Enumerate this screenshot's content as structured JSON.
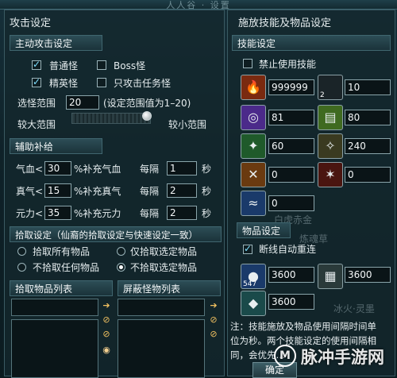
{
  "window": {
    "title": "人人谷 · 设置"
  },
  "left": {
    "section_attack": "攻击设定",
    "section_main_attack": "主动攻击设定",
    "checks": [
      {
        "label": "普通怪",
        "checked": true
      },
      {
        "label": "Boss怪",
        "checked": false
      },
      {
        "label": "精英怪",
        "checked": true
      },
      {
        "label": "只攻击任务怪",
        "checked": false
      }
    ],
    "range_label": "选怪范围",
    "range_value": "20",
    "range_hint": "(设定范围值为1–20)",
    "slider_left": "较大范围",
    "slider_right": "较小范围",
    "slider_level": 0.95,
    "section_supply": "辅助补给",
    "supply": [
      {
        "prefix": "气血<",
        "value": "30",
        "suffix": "%补充气血",
        "every": "每隔",
        "seconds": "1",
        "unit": "秒"
      },
      {
        "prefix": "真气<",
        "value": "15",
        "suffix": "%补充真气",
        "every": "每隔",
        "seconds": "2",
        "unit": "秒"
      },
      {
        "prefix": "元力<",
        "value": "35",
        "suffix": "%补充元力",
        "every": "每隔",
        "seconds": "2",
        "unit": "秒"
      }
    ],
    "section_pickup": "拾取设定（仙裔的拾取设定与快速设定一致）",
    "pickup_options": [
      {
        "label": "拾取所有物品",
        "on": false
      },
      {
        "label": "仅拾取选定物品",
        "on": false
      },
      {
        "label": "不拾取任何物品",
        "on": false
      },
      {
        "label": "不拾取选定物品",
        "on": true
      }
    ],
    "list_pickup": "拾取物品列表",
    "list_block": "屏蔽怪物列表"
  },
  "right": {
    "section_title": "施放技能及物品设定",
    "skill_header": "技能设定",
    "disable_skills": {
      "label": "禁止使用技能",
      "checked": false
    },
    "skills": [
      {
        "icon": "fire-skill-icon",
        "glyph": "🔥",
        "bg": "#7a2a10",
        "value": "999999"
      },
      {
        "icon": "empty-slot-icon",
        "glyph": "",
        "bg": "#1a2428",
        "value": "10",
        "badge": "2"
      },
      {
        "icon": "vortex-skill-icon",
        "glyph": "◎",
        "bg": "#4b2a8a",
        "value": "81"
      },
      {
        "icon": "green-book-icon",
        "glyph": "▤",
        "bg": "#3f6a20",
        "value": "80"
      },
      {
        "icon": "green-slash-icon",
        "glyph": "✦",
        "bg": "#1f5a2a",
        "value": "60"
      },
      {
        "icon": "dark-claw-icon",
        "glyph": "✧",
        "bg": "#3a3a20",
        "value": "240"
      },
      {
        "icon": "cross-slash-icon",
        "glyph": "✕",
        "bg": "#6a3a10",
        "value": "0"
      },
      {
        "icon": "red-spark-icon",
        "glyph": "✶",
        "bg": "#4a1510",
        "value": "0"
      },
      {
        "icon": "blue-wave-icon",
        "glyph": "≈",
        "bg": "#1a3a6a",
        "value": "0"
      }
    ],
    "item_header": "物品设定",
    "auto_reconnect": {
      "label": "断线自动重连",
      "checked": true
    },
    "items": [
      {
        "icon": "blue-orb-item-icon",
        "glyph": "●",
        "bg": "#1a3a6a",
        "badge": "547",
        "value": "3600"
      },
      {
        "icon": "cage-item-icon",
        "glyph": "▦",
        "bg": "#2a3a3a",
        "value": "3600"
      },
      {
        "icon": "teal-item-icon",
        "glyph": "◆",
        "bg": "#1a4a4a",
        "value": "3600"
      }
    ],
    "note": [
      "注：技能施放及物品使用间隔时间单",
      "位为秒。两个技能设定的使用间隔相",
      "同，会优先…"
    ],
    "confirm": "确定"
  },
  "watermark": {
    "text": "脉冲手游网",
    "logo": "M"
  },
  "background_words": [
    "白虎赤金",
    "炼魂草",
    "冰火·灵墨"
  ]
}
